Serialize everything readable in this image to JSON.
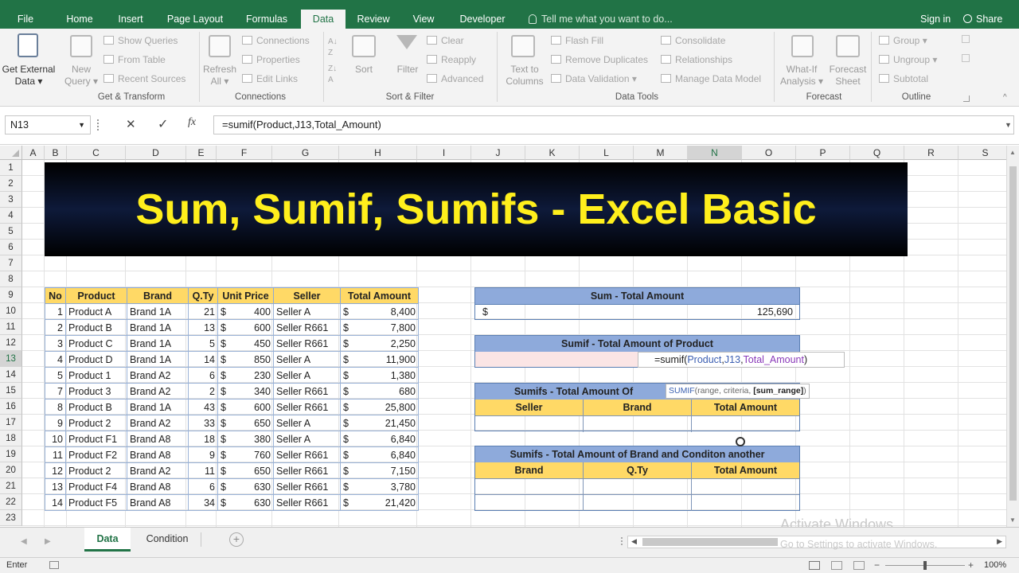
{
  "ribbon_tabs": [
    "File",
    "Home",
    "Insert",
    "Page Layout",
    "Formulas",
    "Data",
    "Review",
    "View",
    "Developer"
  ],
  "active_tab": "Data",
  "tell_me": "Tell me what you want to do...",
  "sign_in": "Sign in",
  "share": "Share",
  "groups": {
    "get_transform": {
      "get_external": "Get External",
      "get_external_2": "Data",
      "new": "New",
      "new_2": "Query",
      "show_queries": "Show Queries",
      "from_table": "From Table",
      "recent_sources": "Recent Sources",
      "label": "Get & Transform"
    },
    "connections": {
      "refresh": "Refresh",
      "refresh_2": "All",
      "connections": "Connections",
      "properties": "Properties",
      "edit_links": "Edit Links",
      "label": "Connections"
    },
    "sort_filter": {
      "sort": "Sort",
      "filter": "Filter",
      "clear": "Clear",
      "reapply": "Reapply",
      "advanced": "Advanced",
      "label": "Sort & Filter"
    },
    "data_tools": {
      "text_to": "Text to",
      "columns": "Columns",
      "flash_fill": "Flash Fill",
      "remove_duplicates": "Remove Duplicates",
      "data_validation": "Data Validation",
      "consolidate": "Consolidate",
      "relationships": "Relationships",
      "manage_data_model": "Manage Data Model",
      "label": "Data Tools"
    },
    "forecast": {
      "what_if": "What-If",
      "what_if_2": "Analysis",
      "forecast": "Forecast",
      "forecast_2": "Sheet",
      "label": "Forecast"
    },
    "outline": {
      "group": "Group",
      "ungroup": "Ungroup",
      "subtotal": "Subtotal",
      "label": "Outline"
    }
  },
  "formula_bar": {
    "name_box": "N13",
    "cancel": "✕",
    "enter": "✓",
    "fx": "fx",
    "formula": "=sumif(Product,J13,Total_Amount)"
  },
  "columns": [
    "A",
    "B",
    "C",
    "D",
    "E",
    "F",
    "G",
    "H",
    "I",
    "J",
    "K",
    "L",
    "M",
    "N",
    "O",
    "P",
    "Q",
    "R",
    "S"
  ],
  "rows": [
    "1",
    "2",
    "3",
    "4",
    "5",
    "6",
    "7",
    "8",
    "9",
    "10",
    "11",
    "12",
    "13",
    "14",
    "15",
    "16",
    "17",
    "18",
    "19",
    "20",
    "21",
    "22",
    "23"
  ],
  "banner_title": "Sum, Sumif, Sumifs - Excel Basic",
  "data_table": {
    "headers": [
      "No",
      "Product",
      "Brand",
      "Q.Ty",
      "Unit Price",
      "Seller",
      "Total Amount"
    ],
    "currency": "$",
    "rows": [
      {
        "no": "1",
        "product": "Product A",
        "brand": "Brand 1A",
        "qty": "21",
        "price": "400",
        "seller": "Seller A",
        "total": "8,400"
      },
      {
        "no": "2",
        "product": "Product B",
        "brand": "Brand 1A",
        "qty": "13",
        "price": "600",
        "seller": "Seller R661",
        "total": "7,800"
      },
      {
        "no": "3",
        "product": "Product C",
        "brand": "Brand 1A",
        "qty": "5",
        "price": "450",
        "seller": "Seller R661",
        "total": "2,250"
      },
      {
        "no": "4",
        "product": "Product D",
        "brand": "Brand 1A",
        "qty": "14",
        "price": "850",
        "seller": "Seller A",
        "total": "11,900"
      },
      {
        "no": "5",
        "product": "Product 1",
        "brand": "Brand A2",
        "qty": "6",
        "price": "230",
        "seller": "Seller A",
        "total": "1,380"
      },
      {
        "no": "7",
        "product": "Product 3",
        "brand": "Brand A2",
        "qty": "2",
        "price": "340",
        "seller": "Seller R661",
        "total": "680"
      },
      {
        "no": "8",
        "product": "Product B",
        "brand": "Brand 1A",
        "qty": "43",
        "price": "600",
        "seller": "Seller R661",
        "total": "25,800"
      },
      {
        "no": "9",
        "product": "Product 2",
        "brand": "Brand A2",
        "qty": "33",
        "price": "650",
        "seller": "Seller A",
        "total": "21,450"
      },
      {
        "no": "10",
        "product": "Product F1",
        "brand": "Brand A8",
        "qty": "18",
        "price": "380",
        "seller": "Seller A",
        "total": "6,840"
      },
      {
        "no": "11",
        "product": "Product F2",
        "brand": "Brand A8",
        "qty": "9",
        "price": "760",
        "seller": "Seller R661",
        "total": "6,840"
      },
      {
        "no": "12",
        "product": "Product 2",
        "brand": "Brand A2",
        "qty": "11",
        "price": "650",
        "seller": "Seller R661",
        "total": "7,150"
      },
      {
        "no": "13",
        "product": "Product F4",
        "brand": "Brand A8",
        "qty": "6",
        "price": "630",
        "seller": "Seller R661",
        "total": "3,780"
      },
      {
        "no": "14",
        "product": "Product F5",
        "brand": "Brand A8",
        "qty": "34",
        "price": "630",
        "seller": "Seller R661",
        "total": "21,420"
      }
    ]
  },
  "sum_box": {
    "title": "Sum - Total Amount",
    "currency": "$",
    "value": "125,690"
  },
  "sumif_box": {
    "title": "Sumif - Total Amount of Product",
    "editing": "=sumif(Product,J13,Total_Amount)"
  },
  "tooltip": {
    "fn": "SUMIF",
    "args": "(range, criteria, ",
    "bold": "[sum_range]",
    "close": ")"
  },
  "sumifs_box": {
    "title": "Sumifs - Total Amount Of",
    "headers": [
      "Seller",
      "Brand",
      "Total Amount"
    ]
  },
  "sumifs_box2": {
    "title": "Sumifs - Total Amount of Brand and Conditon another",
    "headers": [
      "Brand",
      "Q.Ty",
      "Total Amount"
    ]
  },
  "watermark": {
    "line1": "Activate Windows",
    "line2": "Go to Settings to activate Windows."
  },
  "sheet_tabs": [
    "Data",
    "Condition"
  ],
  "active_sheet": "Data",
  "status": {
    "mode": "Enter",
    "zoom": "100%"
  },
  "colors": {
    "excel_green": "#217346",
    "header_yellow": "#ffd966",
    "box_blue": "#8eaadb",
    "title_yellow": "#ffef1c"
  }
}
